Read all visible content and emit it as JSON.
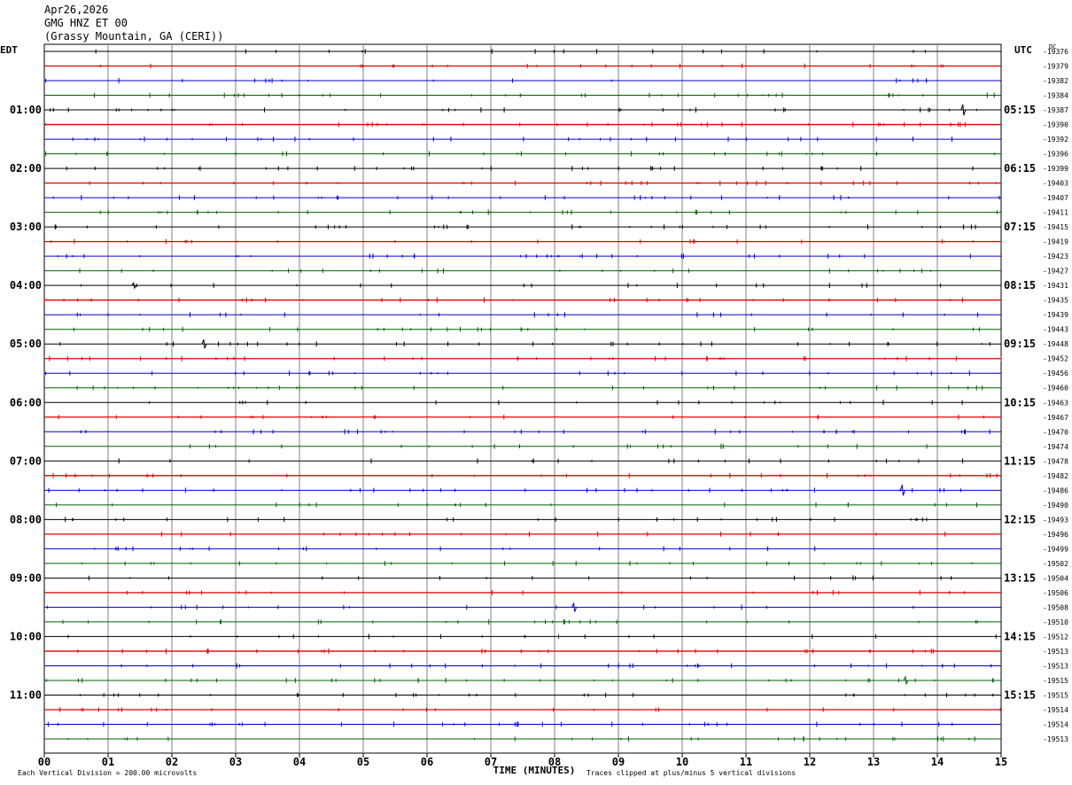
{
  "header": {
    "date": "Apr26,2026",
    "station": "GMG HNZ ET 00",
    "location": "(Grassy Mountain, GA (CERI))"
  },
  "chart_data": {
    "type": "line",
    "left_tz": "EDT",
    "right_tz": "UTC",
    "dc_label": "DC",
    "left_hour_labels": [
      "01:00",
      "02:00",
      "03:00",
      "04:00",
      "05:00",
      "06:00",
      "07:00",
      "08:00",
      "09:00",
      "10:00",
      "11:00"
    ],
    "right_hour_labels": [
      "05:15",
      "06:15",
      "07:15",
      "08:15",
      "09:15",
      "10:15",
      "11:15",
      "12:15",
      "13:15",
      "14:15",
      "15:15"
    ],
    "dc_offsets": [
      -19376,
      -19379,
      -19382,
      -19384,
      -19387,
      -19390,
      -19392,
      -19396,
      -19399,
      -19403,
      -19407,
      -19411,
      -19415,
      -19419,
      -19423,
      -19427,
      -19431,
      -19435,
      -19439,
      -19443,
      -19448,
      -19452,
      -19456,
      -19460,
      -19463,
      -19467,
      -19470,
      -19474,
      -19478,
      -19482,
      -19486,
      -19490,
      -19493,
      -19496,
      -19499,
      -19502,
      -19504,
      -19506,
      -19508,
      -19510,
      -19512,
      -19513,
      -19513,
      -19515,
      -19515,
      -19514,
      -19514,
      -19513
    ],
    "trace_colors": [
      "#000000",
      "#e00000",
      "#0000d0",
      "#006000"
    ],
    "x_ticks": [
      "00",
      "01",
      "02",
      "03",
      "04",
      "05",
      "06",
      "07",
      "08",
      "09",
      "10",
      "11",
      "12",
      "13",
      "14",
      "15"
    ],
    "xlabel": "TIME (MINUTES)",
    "xlim": [
      0,
      15
    ],
    "scale_note": "Each Vertical Division =  200.00 microvolts",
    "clip_note": "Traces clipped at plus/minus 5 vertical divisions",
    "num_traces": 48
  }
}
